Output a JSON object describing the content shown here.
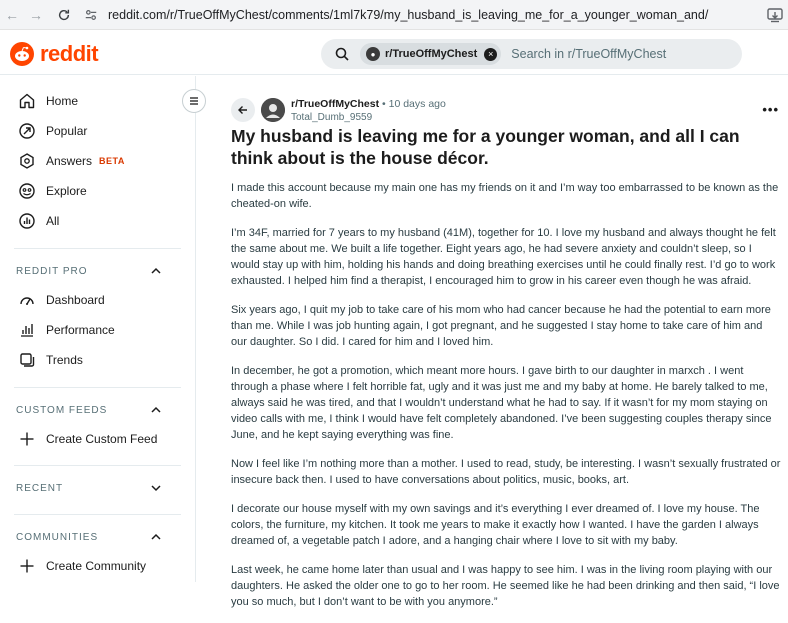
{
  "browser": {
    "url": "reddit.com/r/TrueOffMyChest/comments/1ml7k79/my_husband_is_leaving_me_for_a_younger_woman_and/"
  },
  "header": {
    "logo_text": "reddit",
    "search_chip": "r/TrueOffMyChest",
    "search_placeholder": "Search in r/TrueOffMyChest",
    "brand_color": "#ff4500"
  },
  "sidebar": {
    "main_items": [
      {
        "label": "Home",
        "icon": "home-icon"
      },
      {
        "label": "Popular",
        "icon": "popular-icon"
      },
      {
        "label": "Answers",
        "badge": "BETA",
        "icon": "answers-icon"
      },
      {
        "label": "Explore",
        "icon": "explore-icon"
      },
      {
        "label": "All",
        "icon": "all-icon"
      }
    ],
    "reddit_pro": {
      "title": "REDDIT PRO",
      "items": [
        {
          "label": "Dashboard",
          "icon": "dashboard-icon"
        },
        {
          "label": "Performance",
          "icon": "performance-icon"
        },
        {
          "label": "Trends",
          "icon": "trends-icon"
        }
      ]
    },
    "custom_feeds": {
      "title": "CUSTOM FEEDS",
      "items": [
        {
          "label": "Create Custom Feed",
          "icon": "plus-icon"
        }
      ]
    },
    "recent": {
      "title": "RECENT"
    },
    "communities": {
      "title": "COMMUNITIES",
      "items": [
        {
          "label": "Create Community",
          "icon": "plus-icon"
        }
      ]
    }
  },
  "post": {
    "subreddit": "r/TrueOffMyChest",
    "time": "10 days ago",
    "author": "Total_Dumb_9559",
    "title": "My husband is leaving me for a younger woman, and all I can think about is the house décor.",
    "paragraphs": [
      "I made this account because my main one has my friends on it and I’m way too embarrassed to be known as the cheated-on wife.",
      "I’m 34F, married for 7 years to my husband (41M), together for 10. I love my husband and always thought he felt the same about me. We built a life together. Eight years ago, he had severe anxiety and couldn’t sleep, so I would stay up with him, holding his hands and doing breathing exercises until he could finally rest. I’d go to work exhausted. I helped him find a therapist, I encouraged him to grow in his career even though he was afraid.",
      "Six years ago, I quit my job to take care of his mom who had cancer because he had the potential to earn more than me. While I was job hunting again, I got pregnant, and he suggested I stay home to take care of him and our daughter. So I did. I cared for him and I loved him.",
      "In december, he got a promotion, which meant more hours. I gave birth to our daughter in marxch . I went through a phase where I felt horrible fat, ugly and it was just me and my baby at home. He barely talked to me, always said he was tired, and that I wouldn’t understand what he had to say. If it wasn’t for my mom staying on video calls with me, I think I would have felt completely abandoned. I’ve been suggesting couples therapy since June, and he kept saying everything was fine.",
      "Now I feel like I’m nothing more than a mother. I used to read, study, be interesting. I wasn’t sexually frustrated or insecure back then. I used to have conversations about politics, music, books, art.",
      "I decorate our house myself with my own savings and it’s everything I ever dreamed of. I love my house. The colors, the furniture, my kitchen. It took me years to make it exactly how I wanted. I have the garden I always dreamed of, a vegetable patch I adore, and a hanging chair where I love to sit with my baby.",
      "Last week, he came home later than usual and I was happy to see him. I was in the living room playing with our daughters. He asked the older one to go to her room. He seemed like he had been drinking and then said, “I love you so much, but I don’t want to be with you anymore.”"
    ]
  }
}
